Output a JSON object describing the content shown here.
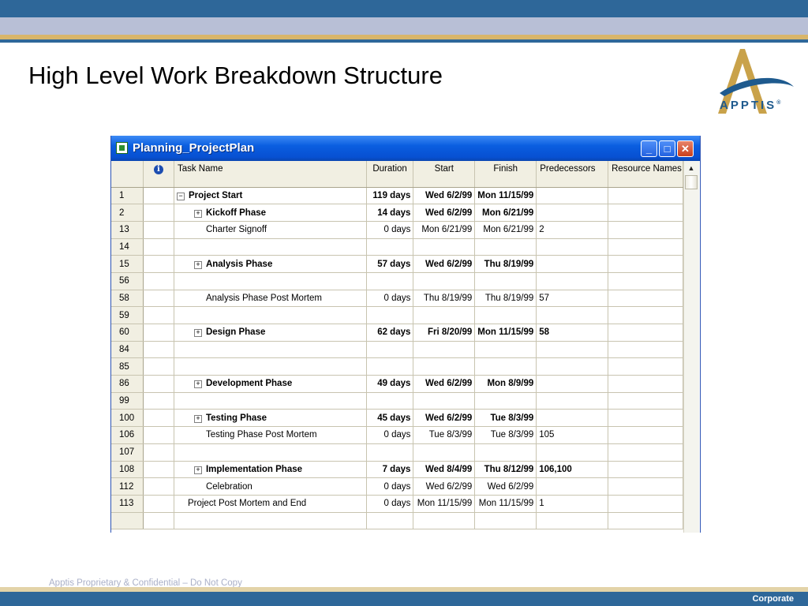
{
  "slide": {
    "title": "High Level Work Breakdown Structure",
    "footer_text": "Apptis Proprietary & Confidential – Do Not Copy",
    "corner_label": "Corporate",
    "logo": {
      "text": "APPTIS",
      "mark": "®",
      "icon": "apptis-a-swoosh-logo",
      "colors": {
        "gold": "#c9a24a",
        "blue": "#1e5a8e"
      }
    }
  },
  "window": {
    "title": "Planning_ProjectPlan",
    "icon": "excel-sheet-icon",
    "controls": {
      "minimize": "_",
      "maximize": "□",
      "close": "✕"
    },
    "titlebar_color": "#0a5ee0"
  },
  "columns": {
    "rownum": "",
    "info": "i",
    "task_name": "Task Name",
    "duration": "Duration",
    "start": "Start",
    "finish": "Finish",
    "predecessors": "Predecessors",
    "resource_names": "Resource Names"
  },
  "rows": [
    {
      "id": "1",
      "toggle": "−",
      "name": "Project Start",
      "duration": "119 days",
      "start": "Wed 6/2/99",
      "finish": "Mon 11/15/99",
      "pred": "",
      "bold": true
    },
    {
      "id": "2",
      "toggle": "+",
      "name": "Kickoff Phase",
      "duration": "14 days",
      "start": "Wed 6/2/99",
      "finish": "Mon 6/21/99",
      "pred": "",
      "bold": true
    },
    {
      "id": "13",
      "toggle": "",
      "name": "Charter Signoff",
      "duration": "0 days",
      "start": "Mon 6/21/99",
      "finish": "Mon 6/21/99",
      "pred": "2",
      "bold": false
    },
    {
      "id": "14",
      "toggle": "",
      "name": "",
      "duration": "",
      "start": "",
      "finish": "",
      "pred": "",
      "bold": false
    },
    {
      "id": "15",
      "toggle": "+",
      "name": "Analysis Phase",
      "duration": "57 days",
      "start": "Wed 6/2/99",
      "finish": "Thu 8/19/99",
      "pred": "",
      "bold": true
    },
    {
      "id": "56",
      "toggle": "",
      "name": "",
      "duration": "",
      "start": "",
      "finish": "",
      "pred": "",
      "bold": false
    },
    {
      "id": "58",
      "toggle": "",
      "name": "Analysis Phase Post Mortem",
      "duration": "0 days",
      "start": "Thu 8/19/99",
      "finish": "Thu 8/19/99",
      "pred": "57",
      "bold": false
    },
    {
      "id": "59",
      "toggle": "",
      "name": "",
      "duration": "",
      "start": "",
      "finish": "",
      "pred": "",
      "bold": false
    },
    {
      "id": "60",
      "toggle": "+",
      "name": "Design Phase",
      "duration": "62 days",
      "start": "Fri 8/20/99",
      "finish": "Mon 11/15/99",
      "pred": "58",
      "bold": true
    },
    {
      "id": "84",
      "toggle": "",
      "name": "",
      "duration": "",
      "start": "",
      "finish": "",
      "pred": "",
      "bold": false
    },
    {
      "id": "85",
      "toggle": "",
      "name": "",
      "duration": "",
      "start": "",
      "finish": "",
      "pred": "",
      "bold": false
    },
    {
      "id": "86",
      "toggle": "+",
      "name": "Development Phase",
      "duration": "49 days",
      "start": "Wed 6/2/99",
      "finish": "Mon 8/9/99",
      "pred": "",
      "bold": true
    },
    {
      "id": "99",
      "toggle": "",
      "name": "",
      "duration": "",
      "start": "",
      "finish": "",
      "pred": "",
      "bold": false
    },
    {
      "id": "100",
      "toggle": "+",
      "name": "Testing Phase",
      "duration": "45 days",
      "start": "Wed 6/2/99",
      "finish": "Tue 8/3/99",
      "pred": "",
      "bold": true
    },
    {
      "id": "106",
      "toggle": "",
      "name": "Testing Phase Post Mortem",
      "duration": "0 days",
      "start": "Tue 8/3/99",
      "finish": "Tue 8/3/99",
      "pred": "105",
      "bold": false
    },
    {
      "id": "107",
      "toggle": "",
      "name": "",
      "duration": "",
      "start": "",
      "finish": "",
      "pred": "",
      "bold": false
    },
    {
      "id": "108",
      "toggle": "+",
      "name": "Implementation Phase",
      "duration": "7 days",
      "start": "Wed 8/4/99",
      "finish": "Thu 8/12/99",
      "pred": "106,100",
      "bold": true
    },
    {
      "id": "112",
      "toggle": "",
      "name": "Celebration",
      "duration": "0 days",
      "start": "Wed 6/2/99",
      "finish": "Wed 6/2/99",
      "pred": "",
      "bold": false
    },
    {
      "id": "113",
      "toggle": "",
      "name": "Project Post Mortem and End",
      "duration": "0 days",
      "start": "Mon 11/15/99",
      "finish": "Mon 11/15/99",
      "pred": "1",
      "bold": false,
      "level": 1
    },
    {
      "id": "",
      "toggle": "",
      "name": "",
      "duration": "",
      "start": "",
      "finish": "",
      "pred": "",
      "bold": false
    }
  ]
}
